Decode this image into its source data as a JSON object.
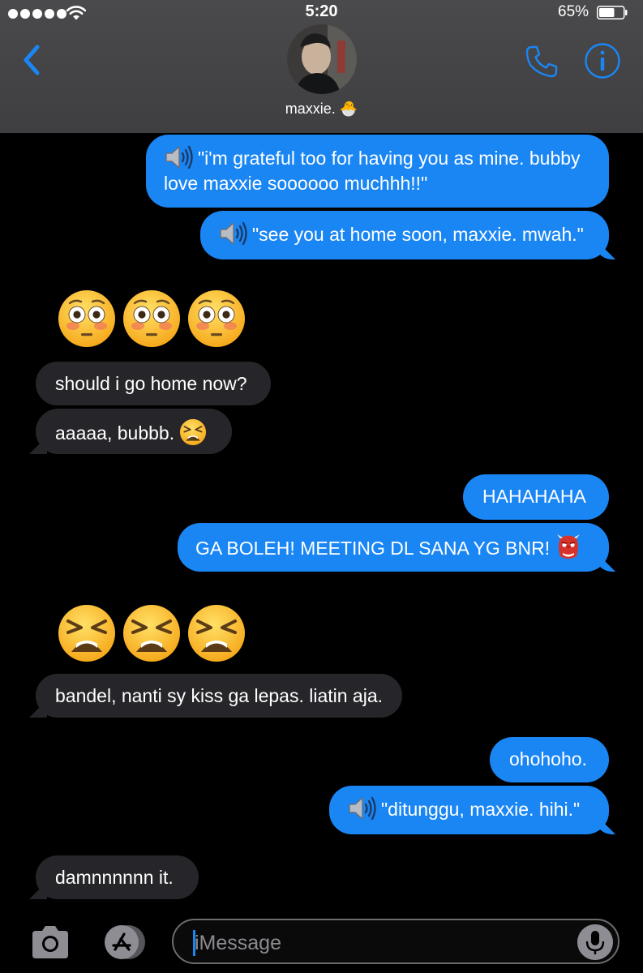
{
  "status_bar": {
    "time": "5:20",
    "battery_percent": "65%",
    "battery_level": 0.65,
    "signal_bars": 5
  },
  "header": {
    "contact_name": "maxxie. 🐣",
    "back_icon": "chevron-left-icon",
    "phone_icon": "phone-icon",
    "info_icon": "info-icon"
  },
  "messages": [
    {
      "direction": "out",
      "voice": true,
      "text_line1": "\"i'm grateful too for having you as mine. bubby",
      "text_line2": "love maxxie soooooo muchhh!!\""
    },
    {
      "direction": "out",
      "voice": true,
      "text": "\"see you at home soon, maxxie. mwah.\""
    },
    {
      "direction": "in",
      "emoji_only": true,
      "emoji": "flushed-face",
      "count": 3
    },
    {
      "direction": "in",
      "text": "should i go home now?"
    },
    {
      "direction": "in",
      "text": "aaaaa, bubbb.",
      "inline_emoji": "tired-face"
    },
    {
      "direction": "out",
      "text": "HAHAHAHA"
    },
    {
      "direction": "out",
      "text": "GA BOLEH! MEETING  DL SANA YG BNR!",
      "inline_emoji": "goblin-mask"
    },
    {
      "direction": "in",
      "emoji_only": true,
      "emoji": "tired-face",
      "count": 3
    },
    {
      "direction": "in",
      "text": "bandel, nanti sy kiss ga lepas. liatin aja."
    },
    {
      "direction": "out",
      "text": "ohohoho."
    },
    {
      "direction": "out",
      "voice": true,
      "text": "\"ditunggu, maxxie. hihi.\""
    },
    {
      "direction": "in",
      "text": "damnnnnnn it."
    }
  ],
  "input_bar": {
    "placeholder": "iMessage",
    "value": ""
  },
  "colors": {
    "outgoing": "#1a86f4",
    "incoming": "#26262a",
    "accent": "#1a86f4"
  }
}
